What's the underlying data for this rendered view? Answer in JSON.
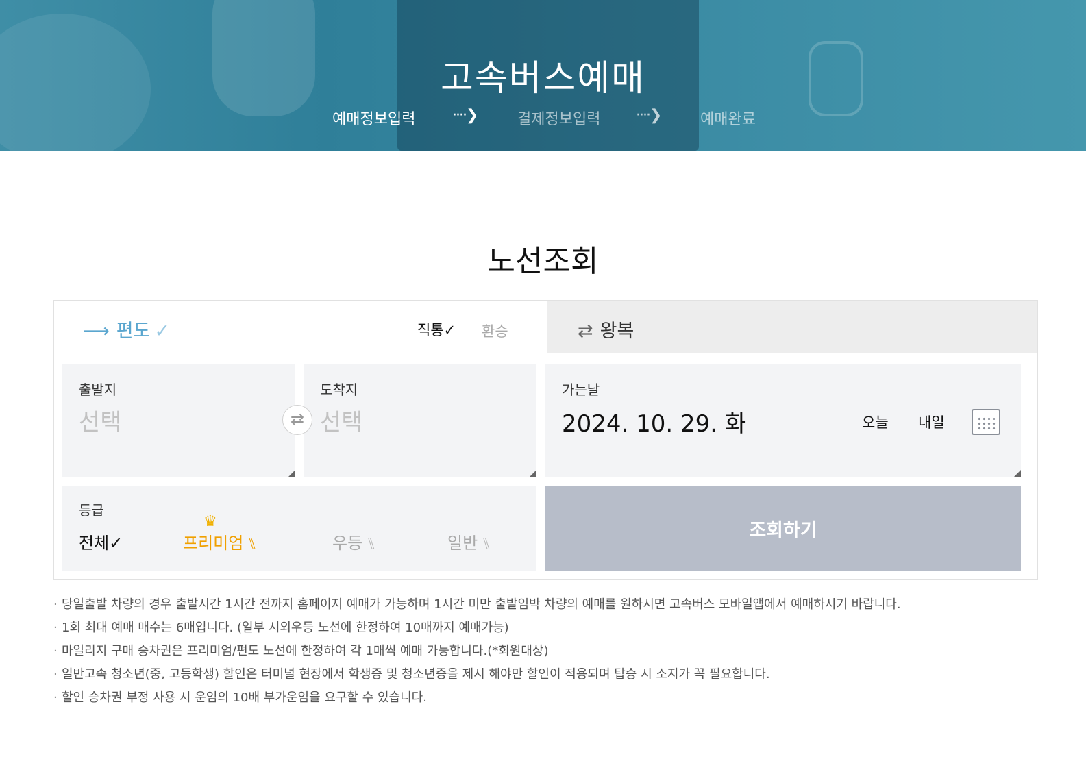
{
  "header": {
    "title": "고속버스예매",
    "steps": [
      {
        "label": "예매정보입력"
      },
      {
        "label": "결제정보입력"
      },
      {
        "label": "예매완료"
      }
    ],
    "step_arrow": "····❯"
  },
  "main": {
    "title": "노선조회",
    "trip_type": {
      "oneway_arrow": "⟶",
      "oneway": "편도",
      "oneway_check": "✓",
      "round_arrow": "⇄",
      "round": "왕복"
    },
    "route": {
      "direct": "직통✓",
      "transfer": "환승"
    },
    "departure": {
      "label": "출발지",
      "value": "선택"
    },
    "arrival": {
      "label": "도착지",
      "value": "선택"
    },
    "swap_icon": "⇄",
    "date": {
      "label": "가는날",
      "value": "2024. 10. 29. 화",
      "today": "오늘",
      "tomorrow": "내일"
    },
    "grade": {
      "label": "등급",
      "all": "전체✓",
      "premium": "프리미엄",
      "excellent": "우등",
      "normal": "일반",
      "crown": "♛",
      "seat": "⑊"
    },
    "search_button": "조회하기"
  },
  "notes": [
    "당일출발 차량의 경우 출발시간 1시간 전까지 홈페이지 예매가 가능하며 1시간 미만 출발임박 차량의 예매를 원하시면 고속버스 모바일앱에서 예매하시기 바랍니다.",
    "1회 최대 예매 매수는 6매입니다. (일부 시외우등 노선에 한정하여 10매까지 예매가능)",
    "마일리지 구매 승차권은 프리미엄/편도 노선에 한정하여 각 1매씩 예매 가능합니다.(*회원대상)",
    "일반고속 청소년(중, 고등학생) 할인은 터미널 현장에서 학생증 및 청소년증을 제시 해야만 할인이 적용되며 탑승 시 소지가 꼭 필요합니다.",
    "할인 승차권 부정 사용 시 운임의 10배 부가운임을 요구할 수 있습니다."
  ]
}
